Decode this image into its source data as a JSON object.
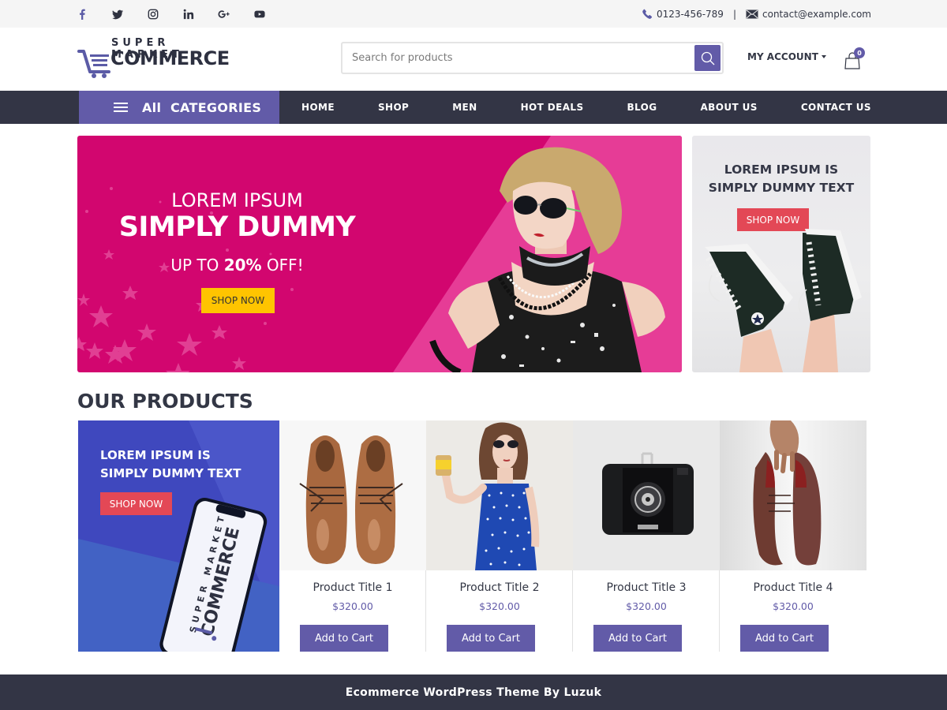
{
  "topbar": {
    "social": [
      {
        "name": "facebook",
        "icon": "facebook-icon"
      },
      {
        "name": "twitter",
        "icon": "twitter-icon"
      },
      {
        "name": "instagram",
        "icon": "instagram-icon"
      },
      {
        "name": "linkedin",
        "icon": "linkedin-icon"
      },
      {
        "name": "google-plus",
        "icon": "google-plus-icon"
      },
      {
        "name": "youtube",
        "icon": "youtube-icon"
      }
    ],
    "phone": "0123-456-789",
    "separator": "|",
    "email": "contact@example.com"
  },
  "header": {
    "logo_top": "SUPER MARKET",
    "logo_main": "COMMERCE",
    "search_placeholder": "Search for products",
    "account_label": "MY ACCOUNT",
    "cart_count": "0"
  },
  "nav": {
    "all_categories": "All  CATEGORIES",
    "items": [
      "HOME",
      "SHOP",
      "MEN",
      "HOT DEALS",
      "BLOG",
      "ABOUT US",
      "CONTACT US"
    ]
  },
  "hero": {
    "line1": "LOREM IPSUM",
    "line2": "SIMPLY DUMMY",
    "line3_prefix": "UP TO ",
    "line3_bold": "20%",
    "line3_suffix": " OFF!",
    "button": "SHOP NOW"
  },
  "side_banner": {
    "line1": "LOREM IPSUM IS",
    "line2": "SIMPLY DUMMY TEXT",
    "button": "SHOP NOW"
  },
  "products_section": {
    "title": "OUR PRODUCTS",
    "promo": {
      "line1": "LOREM IPSUM IS",
      "line2": "SIMPLY DUMMY TEXT",
      "button": "SHOP NOW",
      "phone_logo_top": "SUPER MARKET",
      "phone_logo_main": "COMMERCE"
    },
    "items": [
      {
        "title": "Product Title 1",
        "price": "$320.00",
        "button": "Add to Cart",
        "image": "brown-leather-shoes"
      },
      {
        "title": "Product Title 2",
        "price": "$320.00",
        "button": "Add to Cart",
        "image": "woman-blue-dress"
      },
      {
        "title": "Product Title 3",
        "price": "$320.00",
        "button": "Add to Cart",
        "image": "vintage-camera"
      },
      {
        "title": "Product Title 4",
        "price": "$320.00",
        "button": "Add to Cart",
        "image": "worn-shoes-in-hand"
      }
    ]
  },
  "footer": {
    "text": "Ecommerce WordPress Theme By Luzuk"
  },
  "colors": {
    "accent": "#625ba8",
    "dark": "#333545",
    "hero_pink": "#d2066f",
    "cta_yellow": "#ffc400",
    "cta_red": "#e34856"
  }
}
